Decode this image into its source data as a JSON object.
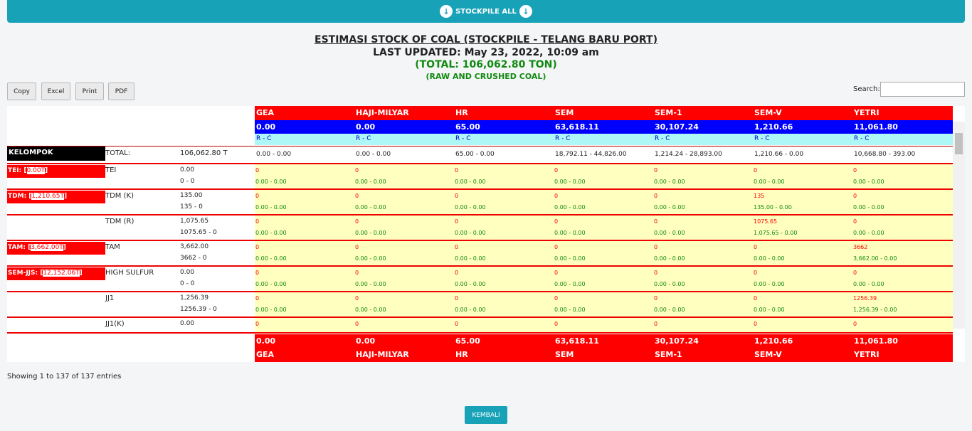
{
  "topbar": {
    "label": "STOCKPILE ALL",
    "icon": "arrow-circle-down-icon"
  },
  "header": {
    "title": "ESTIMASI STOCK OF COAL (STOCKPILE - TELANG BARU PORT)",
    "updated": "LAST UPDATED: May 23, 2022, 10:09 am",
    "total": "(TOTAL: 106,062.80 TON)",
    "subtitle": "(RAW AND CRUSHED COAL)"
  },
  "buttons": {
    "copy": "Copy",
    "excel": "Excel",
    "print": "Print",
    "pdf": "PDF"
  },
  "search": {
    "label": "Search:",
    "value": "",
    "placeholder": ""
  },
  "columns": [
    {
      "name": "GEA",
      "total": "0.00",
      "rc": "R - C",
      "detail": "0.00 - 0.00"
    },
    {
      "name": "HAJI-MILYAR",
      "total": "0.00",
      "rc": "R - C",
      "detail": "0.00 - 0.00"
    },
    {
      "name": "HR",
      "total": "65.00",
      "rc": "R - C",
      "detail": "65.00 - 0.00"
    },
    {
      "name": "SEM",
      "total": "63,618.11",
      "rc": "R - C",
      "detail": "18,792.11 - 44,826.00"
    },
    {
      "name": "SEM-1",
      "total": "30,107.24",
      "rc": "R - C",
      "detail": "1,214.24 - 28,893.00"
    },
    {
      "name": "SEM-V",
      "total": "1,210.66",
      "rc": "R - C",
      "detail": "1,210.66 - 0.00"
    },
    {
      "name": "YETRI",
      "total": "11,061.80",
      "rc": "R - C",
      "detail": "10,668.80 - 393.00"
    }
  ],
  "total_row": {
    "kelompok": "KELOMPOK",
    "label": "TOTAL:",
    "value": "106,062.80 T"
  },
  "groups": [
    {
      "name": "TEI:",
      "val": "0.00T"
    },
    {
      "name": "TDM:",
      "val": "1,210.65T"
    },
    {
      "name": "TAM:",
      "val": "3,662.00T"
    },
    {
      "name": "SEM-JJS:",
      "val": "12,152.06T"
    }
  ],
  "rows": [
    {
      "name": "TEI",
      "v1": "0.00",
      "v2": "0 - 0",
      "cells": [
        [
          "0",
          "0.00 - 0.00"
        ],
        [
          "0",
          "0.00 - 0.00"
        ],
        [
          "0",
          "0.00 - 0.00"
        ],
        [
          "0",
          "0.00 - 0.00"
        ],
        [
          "0",
          "0.00 - 0.00"
        ],
        [
          "0",
          "0.00 - 0.00"
        ],
        [
          "0",
          "0.00 - 0.00"
        ]
      ]
    },
    {
      "name": "TDM (K)",
      "v1": "135.00",
      "v2": "135 - 0",
      "cells": [
        [
          "0",
          "0.00 - 0.00"
        ],
        [
          "0",
          "0.00 - 0.00"
        ],
        [
          "0",
          "0.00 - 0.00"
        ],
        [
          "0",
          "0.00 - 0.00"
        ],
        [
          "0",
          "0.00 - 0.00"
        ],
        [
          "135",
          "135.00 - 0.00"
        ],
        [
          "0",
          "0.00 - 0.00"
        ]
      ]
    },
    {
      "name": "TDM (R)",
      "v1": "1,075.65",
      "v2": "1075.65 - 0",
      "cells": [
        [
          "0",
          "0.00 - 0.00"
        ],
        [
          "0",
          "0.00 - 0.00"
        ],
        [
          "0",
          "0.00 - 0.00"
        ],
        [
          "0",
          "0.00 - 0.00"
        ],
        [
          "0",
          "0.00 - 0.00"
        ],
        [
          "1075.65",
          "1,075.65 - 0.00"
        ],
        [
          "0",
          "0.00 - 0.00"
        ]
      ]
    },
    {
      "name": "TAM",
      "v1": "3,662.00",
      "v2": "3662 - 0",
      "cells": [
        [
          "0",
          "0.00 - 0.00"
        ],
        [
          "0",
          "0.00 - 0.00"
        ],
        [
          "0",
          "0.00 - 0.00"
        ],
        [
          "0",
          "0.00 - 0.00"
        ],
        [
          "0",
          "0.00 - 0.00"
        ],
        [
          "0",
          "0.00 - 0.00"
        ],
        [
          "3662",
          "3,662.00 - 0.00"
        ]
      ]
    },
    {
      "name": "HIGH SULFUR",
      "v1": "0.00",
      "v2": "0 - 0",
      "cells": [
        [
          "0",
          "0.00 - 0.00"
        ],
        [
          "0",
          "0.00 - 0.00"
        ],
        [
          "0",
          "0.00 - 0.00"
        ],
        [
          "0",
          "0.00 - 0.00"
        ],
        [
          "0",
          "0.00 - 0.00"
        ],
        [
          "0",
          "0.00 - 0.00"
        ],
        [
          "0",
          "0.00 - 0.00"
        ]
      ]
    },
    {
      "name": "JJ1",
      "v1": "1,256.39",
      "v2": "1256.39 - 0",
      "cells": [
        [
          "0",
          "0.00 - 0.00"
        ],
        [
          "0",
          "0.00 - 0.00"
        ],
        [
          "0",
          "0.00 - 0.00"
        ],
        [
          "0",
          "0.00 - 0.00"
        ],
        [
          "0",
          "0.00 - 0.00"
        ],
        [
          "0",
          "0.00 - 0.00"
        ],
        [
          "1256.39",
          "1,256.39 - 0.00"
        ]
      ]
    },
    {
      "name": "JJ1(K)",
      "v1": "0.00",
      "v2": "",
      "cells": [
        [
          "0",
          ""
        ],
        [
          "0",
          ""
        ],
        [
          "0",
          ""
        ],
        [
          "0",
          ""
        ],
        [
          "0",
          ""
        ],
        [
          "0",
          ""
        ],
        [
          "0",
          ""
        ]
      ]
    }
  ],
  "footer_info": "Showing 1 to 137 of 137 entries",
  "kembali": "KEMBALI"
}
